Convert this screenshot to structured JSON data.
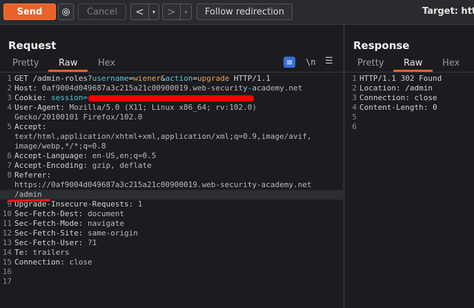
{
  "toolbar": {
    "send_label": "Send",
    "cancel_label": "Cancel",
    "back_glyph": "<",
    "forward_glyph": ">",
    "dropdown_glyph": "▾",
    "follow_label": "Follow redirection",
    "target_label": "Target: http"
  },
  "request": {
    "title": "Request",
    "tabs": [
      "Pretty",
      "Raw",
      "Hex"
    ],
    "active_tab": "Raw",
    "icons": [
      "wrap-lines-icon",
      "newline-icon",
      "menu-icon"
    ],
    "newline_glyph": "\\n",
    "lines": [
      {
        "n": "1",
        "method": "GET ",
        "path": "/admin-roles?",
        "p1": "username",
        "eq1": "=",
        "v1": "wiener",
        "amp": "&",
        "p2": "action",
        "eq2": "=",
        "v2": "upgrade",
        "proto": " HTTP/1.1"
      },
      {
        "n": "2",
        "key": "Host:",
        "val": " 0af9004d049687a3c215a21c00900019.web-security-academy.net"
      },
      {
        "n": "3",
        "key": "Cookie:",
        "cookie": " session="
      },
      {
        "n": "4",
        "key": "User-Agent:",
        "val": " Mozilla/5.0 (X11; Linux x86_64; rv:102.0)"
      },
      {
        "n": "",
        "val": "Gecko/20100101 Firefox/102.0"
      },
      {
        "n": "5",
        "key": "Accept:",
        "val": ""
      },
      {
        "n": "",
        "val": "text/html,application/xhtml+xml,application/xml;q=0.9,image/avif,"
      },
      {
        "n": "",
        "val": "image/webp,*/*;q=0.8"
      },
      {
        "n": "6",
        "key": "Accept-Language:",
        "val": " en-US,en;q=0.5"
      },
      {
        "n": "7",
        "key": "Accept-Encoding:",
        "val": " gzip, deflate"
      },
      {
        "n": "8",
        "key": "Referer:",
        "val": ""
      },
      {
        "n": "",
        "val": "https://0af9004d049687a3c215a21c00900019.web-security-academy.net"
      },
      {
        "n": "",
        "val": "/admin"
      },
      {
        "n": "9",
        "key": "Upgrade-Insecure-Requests:",
        "val": " 1"
      },
      {
        "n": "10",
        "key": "Sec-Fetch-Dest:",
        "val": " document"
      },
      {
        "n": "11",
        "key": "Sec-Fetch-Mode:",
        "val": " navigate"
      },
      {
        "n": "12",
        "key": "Sec-Fetch-Site:",
        "val": " same-origin"
      },
      {
        "n": "13",
        "key": "Sec-Fetch-User:",
        "val": " ?1"
      },
      {
        "n": "14",
        "key": "Te:",
        "val": " trailers"
      },
      {
        "n": "15",
        "key": "Connection:",
        "val": " close"
      },
      {
        "n": "16",
        "val": ""
      },
      {
        "n": "17",
        "val": ""
      }
    ]
  },
  "response": {
    "title": "Response",
    "tabs": [
      "Pretty",
      "Raw",
      "Hex"
    ],
    "active_tab": "Raw",
    "lines": [
      {
        "n": "1",
        "val": "HTTP/1.1 302 Found"
      },
      {
        "n": "2",
        "val": "Location: /admin"
      },
      {
        "n": "3",
        "val": "Connection: close"
      },
      {
        "n": "4",
        "val": "Content-Length: 0"
      },
      {
        "n": "5",
        "val": ""
      },
      {
        "n": "6",
        "val": ""
      }
    ]
  },
  "colors": {
    "accent": "#e8622a",
    "background": "#1b1c1f",
    "cookie_name": "#5cc2d9",
    "param_value": "#e8a15a",
    "redaction": "#ff0000"
  }
}
